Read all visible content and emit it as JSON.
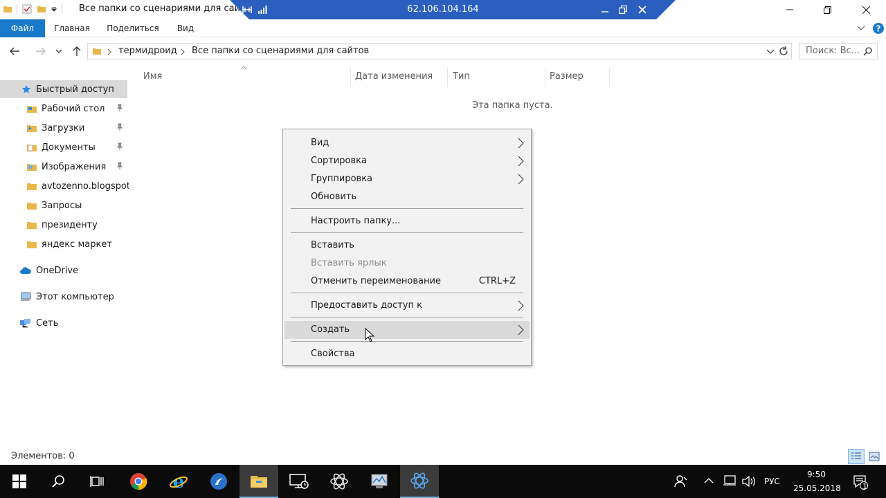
{
  "window": {
    "title": "Все папки со сценариями для сайтов"
  },
  "remote": {
    "ip": "62.106.104.164"
  },
  "ribbon": {
    "tabs": [
      "Файл",
      "Главная",
      "Поделиться",
      "Вид"
    ]
  },
  "address": {
    "crumbs": [
      "термидроид",
      "Все папки со сценариями для сайтов"
    ],
    "search_placeholder": "Поиск: Вс..."
  },
  "nav": {
    "quick_access": "Быстрый доступ",
    "pinned": [
      "Рабочий стол",
      "Загрузки",
      "Документы",
      "Изображения"
    ],
    "folders": [
      "avtozenno.blogspot",
      "Запросы",
      "президенту",
      "яндекс маркет"
    ],
    "onedrive": "OneDrive",
    "this_pc": "Этот компьютер",
    "network": "Сеть"
  },
  "columns": [
    "Имя",
    "Дата изменения",
    "Тип",
    "Размер"
  ],
  "empty_message": "Эта папка пуста.",
  "context_menu": {
    "items": [
      {
        "label": "Вид",
        "submenu": true
      },
      {
        "label": "Сортировка",
        "submenu": true
      },
      {
        "label": "Группировка",
        "submenu": true
      },
      {
        "label": "Обновить"
      },
      {
        "label": "Настроить папку..."
      },
      {
        "label": "Вставить"
      },
      {
        "label": "Вставить ярлык",
        "disabled": true
      },
      {
        "label": "Отменить переименование",
        "shortcut": "CTRL+Z"
      },
      {
        "label": "Предоставить доступ к",
        "submenu": true
      },
      {
        "label": "Создать",
        "submenu": true,
        "highlighted": true
      },
      {
        "label": "Свойства"
      }
    ]
  },
  "status": {
    "items_count": "Элементов: 0"
  },
  "taskbar": {
    "language": "РУС",
    "time": "9:50",
    "date": "25.05.2018",
    "notification_count": "1"
  },
  "colors": {
    "accent": "#1979ca",
    "rdp_bar": "#2a5fbf",
    "highlight": "#dadada",
    "taskbar": "#0b0b0b"
  }
}
